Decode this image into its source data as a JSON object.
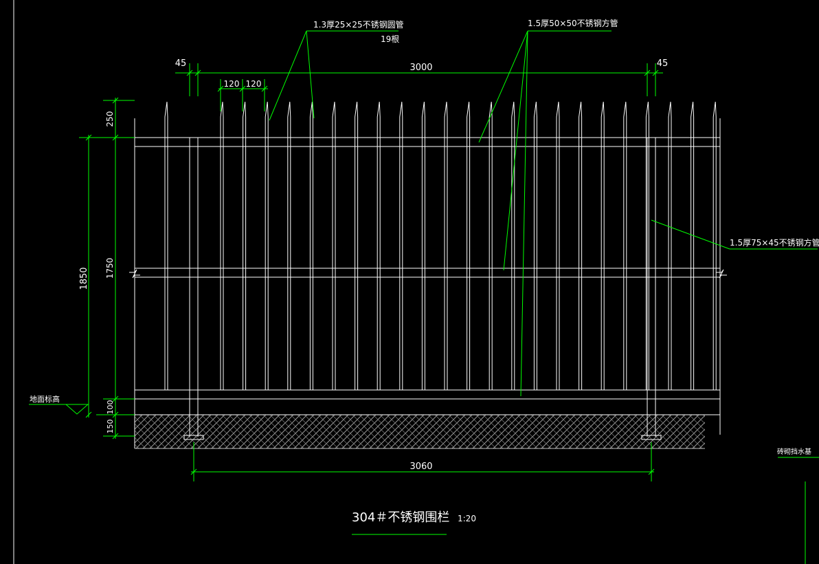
{
  "colors": {
    "background": "#000000",
    "geometry": "#ffffff",
    "dimension": "#00ff00",
    "title": "#ffffff"
  },
  "annotations": {
    "round_tube": "1.3厚25×25不锈钢圆管",
    "round_tube_count": "19根",
    "square_tube_50": "1.5厚50×50不锈钢方管",
    "square_tube_75": "1.5厚75×45不锈钢方管",
    "ground_level": "地面标高",
    "side_note": "砖砌挡水基"
  },
  "dimensions": {
    "left_offset": "45",
    "right_offset": "45",
    "span_top": "3000",
    "spacing_1": "120",
    "spacing_2": "120",
    "spike_height": "250",
    "fence_height": "1750",
    "total_height": "1850",
    "bottom_rail": "100",
    "base_depth": "150",
    "span_bottom": "3060"
  },
  "title": {
    "main": "304＃不锈钢围栏",
    "scale": "1:20"
  },
  "picket_count": 19
}
